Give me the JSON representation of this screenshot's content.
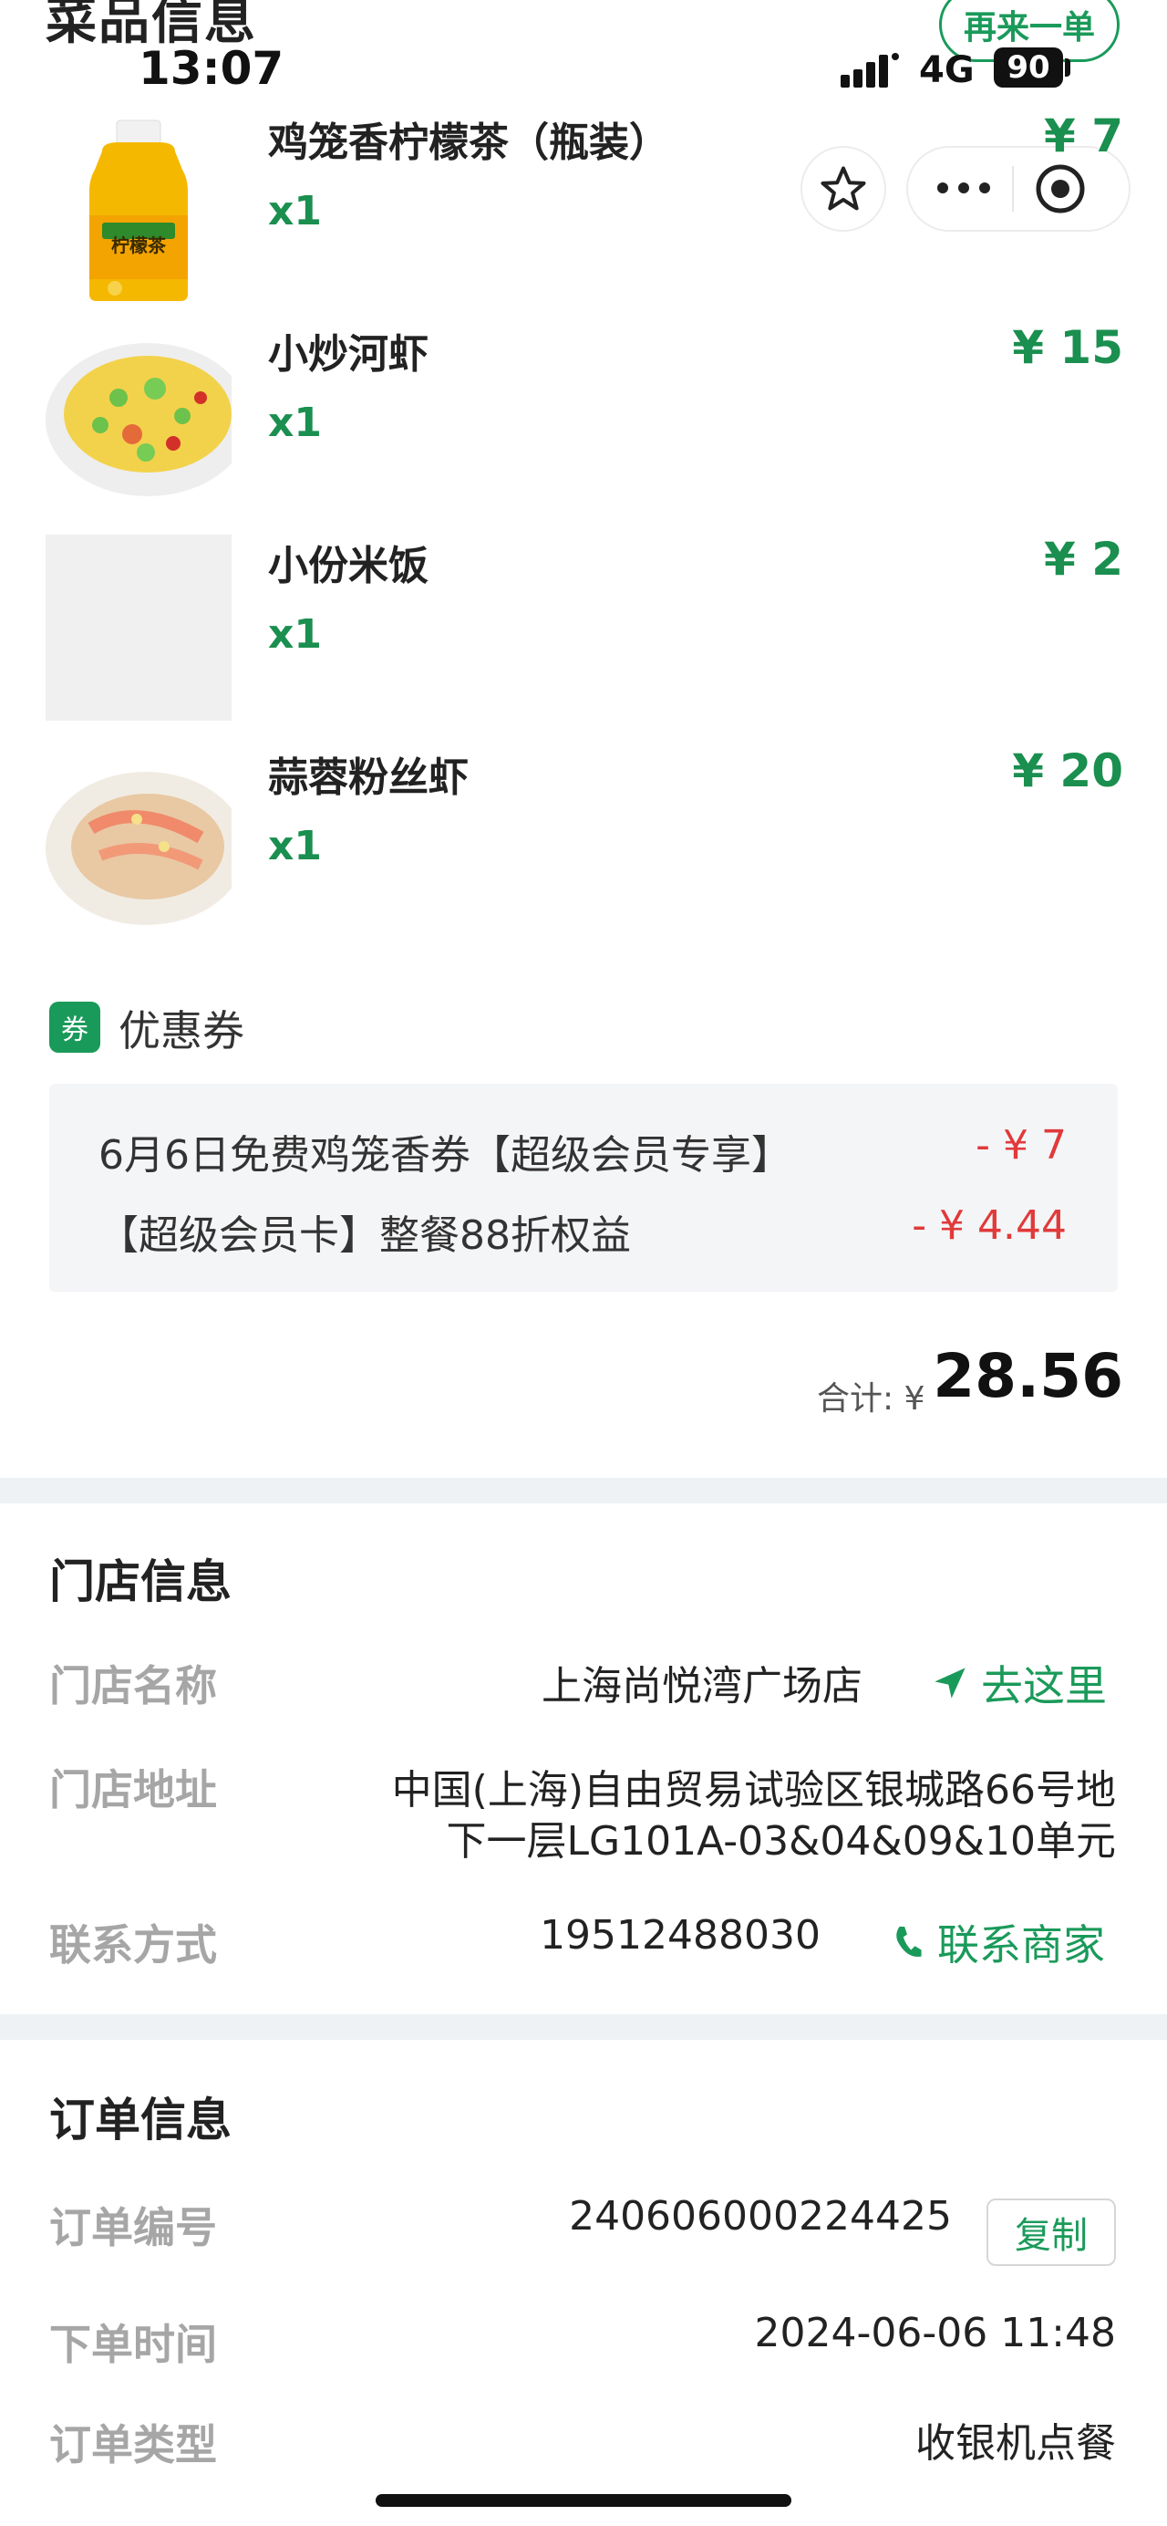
{
  "header": {
    "section_title": "菜品信息",
    "reorder_label": "再来一单",
    "time": "13:07",
    "network": "4G",
    "battery": "90"
  },
  "items": [
    {
      "name": "鸡笼香柠檬茶（瓶装）",
      "qty": "x1",
      "price": "¥ 7",
      "image": "lemon-tea-bottle"
    },
    {
      "name": "小炒河虾",
      "qty": "x1",
      "price": "¥ 15",
      "image": "stir-fried-shrimp"
    },
    {
      "name": "小份米饭",
      "qty": "x1",
      "price": "¥ 2",
      "image": "placeholder"
    },
    {
      "name": "蒜蓉粉丝虾",
      "qty": "x1",
      "price": "¥ 20",
      "image": "garlic-vermicelli-shrimp"
    }
  ],
  "coupons": {
    "badge": "券",
    "title": "优惠券",
    "list": [
      {
        "name": "6月6日免费鸡笼香券【超级会员专享】",
        "amount": "- ¥ 7"
      },
      {
        "name": "【超级会员卡】整餐88折权益",
        "amount": "- ¥ 4.44"
      }
    ]
  },
  "total": {
    "label": "合计: ¥",
    "value": "28.56"
  },
  "store": {
    "title": "门店信息",
    "name_label": "门店名称",
    "name_value": "上海尚悦湾广场店",
    "navigate": "去这里",
    "address_label": "门店地址",
    "address_line1": "中国(上海)自由贸易试验区银城路66号地",
    "address_line2": "下一层LG101A-03&04&09&10单元",
    "contact_label": "联系方式",
    "contact_value": "19512488030",
    "contact_action": "联系商家"
  },
  "order": {
    "title": "订单信息",
    "number_label": "订单编号",
    "number_value": "240606000224425",
    "copy": "复制",
    "time_label": "下单时间",
    "time_value": "2024-06-06 11:48",
    "type_label": "订单类型",
    "type_value": "收银机点餐"
  },
  "colors": {
    "accent": "#1a9a5a",
    "price": "#1a8f4f",
    "discount": "#e03a3a"
  }
}
